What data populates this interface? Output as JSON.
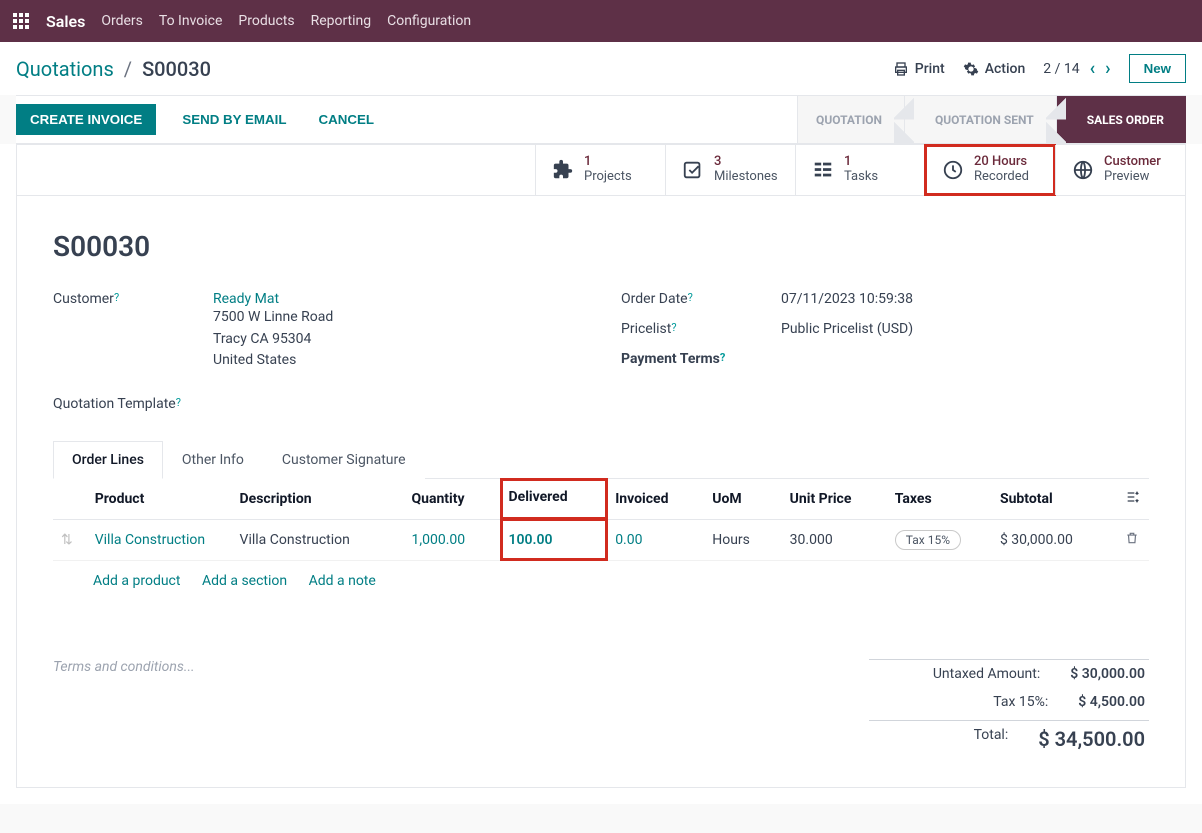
{
  "nav": {
    "app": "Sales",
    "links": [
      "Orders",
      "To Invoice",
      "Products",
      "Reporting",
      "Configuration"
    ]
  },
  "crumb": {
    "root": "Quotations",
    "sep": "/",
    "leaf": "S00030"
  },
  "actions": {
    "print": "Print",
    "action": "Action",
    "pager": "2 / 14",
    "new": "New"
  },
  "cmd": {
    "create_invoice": "CREATE INVOICE",
    "send_email": "SEND BY EMAIL",
    "cancel": "CANCEL"
  },
  "status": {
    "quotation": "QUOTATION",
    "quotation_sent": "QUOTATION SENT",
    "sales_order": "SALES ORDER"
  },
  "stats": {
    "projects": {
      "count": "1",
      "label": "Projects"
    },
    "milestones": {
      "count": "3",
      "label": "Milestones"
    },
    "tasks": {
      "count": "1",
      "label": "Tasks"
    },
    "recorded": {
      "count": "20 Hours",
      "label": "Recorded"
    },
    "preview": {
      "count": "Customer",
      "label": "Preview"
    }
  },
  "record": {
    "name": "S00030",
    "customer_label": "Customer",
    "customer_name": "Ready Mat",
    "addr1": "7500 W Linne Road",
    "addr2": "Tracy CA 95304",
    "addr3": "United States",
    "qt_template_label": "Quotation Template",
    "order_date_label": "Order Date",
    "order_date": "07/11/2023 10:59:38",
    "pricelist_label": "Pricelist",
    "pricelist": "Public Pricelist (USD)",
    "payment_terms_label": "Payment Terms"
  },
  "tabs": {
    "order_lines": "Order Lines",
    "other_info": "Other Info",
    "cust_sig": "Customer Signature"
  },
  "lines": {
    "headers": {
      "product": "Product",
      "description": "Description",
      "quantity": "Quantity",
      "delivered": "Delivered",
      "invoiced": "Invoiced",
      "uom": "UoM",
      "unit_price": "Unit Price",
      "taxes": "Taxes",
      "subtotal": "Subtotal"
    },
    "rows": [
      {
        "product": "Villa Construction",
        "description": "Villa Construction",
        "quantity": "1,000.00",
        "delivered": "100.00",
        "invoiced": "0.00",
        "uom": "Hours",
        "unit_price": "30.000",
        "tax": "Tax 15%",
        "subtotal": "$ 30,000.00"
      }
    ],
    "add_product": "Add a product",
    "add_section": "Add a section",
    "add_note": "Add a note"
  },
  "terms_placeholder": "Terms and conditions...",
  "totals": {
    "untaxed_label": "Untaxed Amount:",
    "untaxed": "$ 30,000.00",
    "tax_label": "Tax 15%:",
    "tax": "$ 4,500.00",
    "total_label": "Total:",
    "total": "$ 34,500.00"
  }
}
